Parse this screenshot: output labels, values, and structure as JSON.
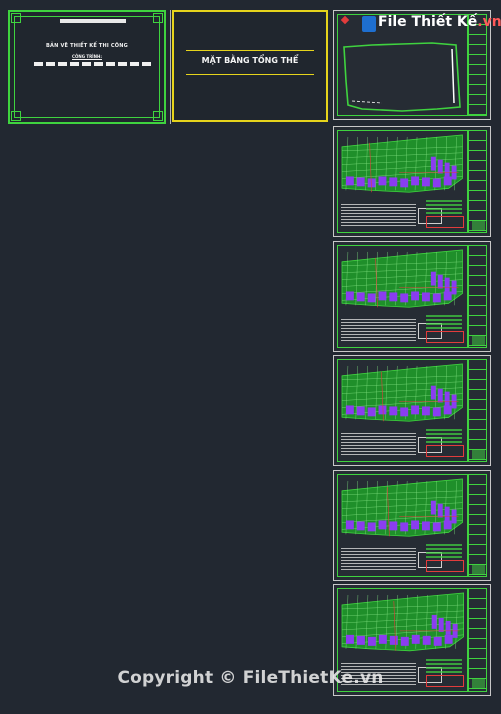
{
  "cover": {
    "title": "BẢN VẼ THIẾT KẾ THI CÔNG",
    "subtitle": "CÔNG TRÌNH:"
  },
  "title_sheet": {
    "title": "MẶT BẰNG TỔNG THỂ"
  },
  "watermark": {
    "brand_prefix": "File Thiết Kế",
    "brand_suffix": ".vn"
  },
  "footer": {
    "copyright": "Copyright © FileThietKe.vn"
  },
  "sheets": [
    {
      "kind": "outline"
    },
    {
      "kind": "plan"
    },
    {
      "kind": "plan"
    },
    {
      "kind": "plan"
    },
    {
      "kind": "plan"
    },
    {
      "kind": "plan"
    }
  ],
  "colors": {
    "background": "#222831",
    "frame_green": "#3fd33f",
    "frame_yellow": "#e6d41c",
    "plan_fill": "#1f8f2a",
    "purple_blocks": "#8a3df0",
    "red_lines": "#e23c3c"
  }
}
